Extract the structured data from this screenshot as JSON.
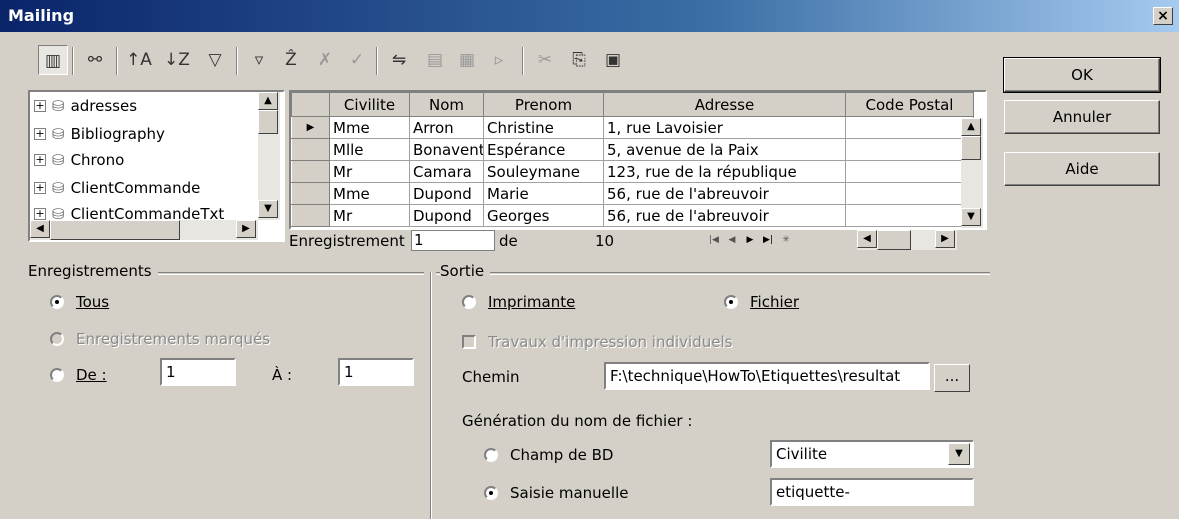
{
  "window": {
    "title": "Mailing",
    "close": "×"
  },
  "toolbar": {
    "icons": [
      "explorer-icon",
      "binoculars-icon",
      "sort-ascending-icon",
      "sort-descending-icon",
      "autofilter-icon",
      "filter-icon",
      "standard-filter-icon",
      "remove-filter-icon",
      "apply-filter-icon",
      "data-to-text-icon",
      "data-to-fields-icon",
      "mail-merge-icon",
      "cut-icon",
      "copy-icon",
      "paste-icon"
    ]
  },
  "tree": {
    "items": [
      "adresses",
      "Bibliography",
      "Chrono",
      "ClientCommande",
      "ClientCommandeTxt"
    ],
    "expander": "⊞"
  },
  "grid": {
    "columns": [
      "Civilite",
      "Nom",
      "Prenom",
      "Adresse",
      "Code Postal"
    ],
    "rows": [
      [
        "Mme",
        "Arron",
        "Christine",
        "1, rue Lavoisier",
        ""
      ],
      [
        "Mlle",
        "Bonaventure",
        "Espérance",
        "5, avenue de la Paix",
        ""
      ],
      [
        "Mr",
        "Camara",
        "Souleymane",
        "123, rue de la république",
        ""
      ],
      [
        "Mme",
        "Dupond",
        "Marie",
        "56, rue de l'abreuvoir",
        ""
      ],
      [
        "Mr",
        "Dupond",
        "Georges",
        "56, rue de l'abreuvoir",
        ""
      ]
    ],
    "nav": {
      "label": "Enregistrement",
      "current": "1",
      "of": "de",
      "total": "10"
    }
  },
  "enregistrements": {
    "group_label": "Enregistrements",
    "tous": "Tous",
    "marques": "Enregistrements marqués",
    "de": "De :",
    "a": "À :",
    "de_value": "1",
    "a_value": "1"
  },
  "sortie": {
    "group_label": "Sortie",
    "imprimante": "Imprimante",
    "fichier": "Fichier",
    "travaux": "Travaux d'impression individuels",
    "chemin_label": "Chemin",
    "chemin_value": "F:\\technique\\HowTo\\Etiquettes\\resultat",
    "browse": "...",
    "generation_label": "Génération du nom de fichier :",
    "champ_bd": "Champ de BD",
    "champ_value": "Civilite",
    "saisie": "Saisie manuelle",
    "saisie_value": "etiquette-"
  },
  "buttons": {
    "ok": "OK",
    "annuler": "Annuler",
    "aide": "Aide"
  }
}
